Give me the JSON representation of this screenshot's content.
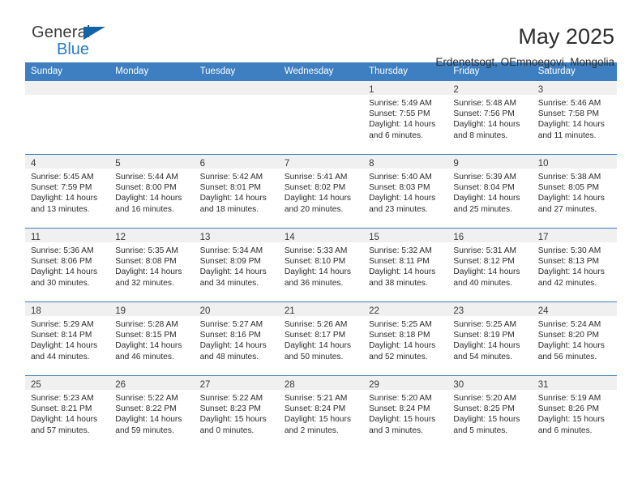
{
  "brand": {
    "name_part1": "General",
    "name_part2": "Blue",
    "accent_color": "#2a7cc7",
    "triangle_color": "#1263a8",
    "triangle_icon": "triangle-icon"
  },
  "header": {
    "title": "May 2025",
    "subtitle": "Erdenetsogt, OEmnoegovi, Mongolia"
  },
  "calendar": {
    "header_bg": "#3d7fc1",
    "header_text_color": "#ffffff",
    "daynum_band_bg": "#f0f0f0",
    "weekdays": [
      "Sunday",
      "Monday",
      "Tuesday",
      "Wednesday",
      "Thursday",
      "Friday",
      "Saturday"
    ],
    "weeks": [
      [
        {
          "day": "",
          "empty": true
        },
        {
          "day": "",
          "empty": true
        },
        {
          "day": "",
          "empty": true
        },
        {
          "day": "",
          "empty": true
        },
        {
          "day": "1",
          "sunrise": "Sunrise: 5:49 AM",
          "sunset": "Sunset: 7:55 PM",
          "daylight1": "Daylight: 14 hours",
          "daylight2": "and 6 minutes."
        },
        {
          "day": "2",
          "sunrise": "Sunrise: 5:48 AM",
          "sunset": "Sunset: 7:56 PM",
          "daylight1": "Daylight: 14 hours",
          "daylight2": "and 8 minutes."
        },
        {
          "day": "3",
          "sunrise": "Sunrise: 5:46 AM",
          "sunset": "Sunset: 7:58 PM",
          "daylight1": "Daylight: 14 hours",
          "daylight2": "and 11 minutes."
        }
      ],
      [
        {
          "day": "4",
          "sunrise": "Sunrise: 5:45 AM",
          "sunset": "Sunset: 7:59 PM",
          "daylight1": "Daylight: 14 hours",
          "daylight2": "and 13 minutes."
        },
        {
          "day": "5",
          "sunrise": "Sunrise: 5:44 AM",
          "sunset": "Sunset: 8:00 PM",
          "daylight1": "Daylight: 14 hours",
          "daylight2": "and 16 minutes."
        },
        {
          "day": "6",
          "sunrise": "Sunrise: 5:42 AM",
          "sunset": "Sunset: 8:01 PM",
          "daylight1": "Daylight: 14 hours",
          "daylight2": "and 18 minutes."
        },
        {
          "day": "7",
          "sunrise": "Sunrise: 5:41 AM",
          "sunset": "Sunset: 8:02 PM",
          "daylight1": "Daylight: 14 hours",
          "daylight2": "and 20 minutes."
        },
        {
          "day": "8",
          "sunrise": "Sunrise: 5:40 AM",
          "sunset": "Sunset: 8:03 PM",
          "daylight1": "Daylight: 14 hours",
          "daylight2": "and 23 minutes."
        },
        {
          "day": "9",
          "sunrise": "Sunrise: 5:39 AM",
          "sunset": "Sunset: 8:04 PM",
          "daylight1": "Daylight: 14 hours",
          "daylight2": "and 25 minutes."
        },
        {
          "day": "10",
          "sunrise": "Sunrise: 5:38 AM",
          "sunset": "Sunset: 8:05 PM",
          "daylight1": "Daylight: 14 hours",
          "daylight2": "and 27 minutes."
        }
      ],
      [
        {
          "day": "11",
          "sunrise": "Sunrise: 5:36 AM",
          "sunset": "Sunset: 8:06 PM",
          "daylight1": "Daylight: 14 hours",
          "daylight2": "and 30 minutes."
        },
        {
          "day": "12",
          "sunrise": "Sunrise: 5:35 AM",
          "sunset": "Sunset: 8:08 PM",
          "daylight1": "Daylight: 14 hours",
          "daylight2": "and 32 minutes."
        },
        {
          "day": "13",
          "sunrise": "Sunrise: 5:34 AM",
          "sunset": "Sunset: 8:09 PM",
          "daylight1": "Daylight: 14 hours",
          "daylight2": "and 34 minutes."
        },
        {
          "day": "14",
          "sunrise": "Sunrise: 5:33 AM",
          "sunset": "Sunset: 8:10 PM",
          "daylight1": "Daylight: 14 hours",
          "daylight2": "and 36 minutes."
        },
        {
          "day": "15",
          "sunrise": "Sunrise: 5:32 AM",
          "sunset": "Sunset: 8:11 PM",
          "daylight1": "Daylight: 14 hours",
          "daylight2": "and 38 minutes."
        },
        {
          "day": "16",
          "sunrise": "Sunrise: 5:31 AM",
          "sunset": "Sunset: 8:12 PM",
          "daylight1": "Daylight: 14 hours",
          "daylight2": "and 40 minutes."
        },
        {
          "day": "17",
          "sunrise": "Sunrise: 5:30 AM",
          "sunset": "Sunset: 8:13 PM",
          "daylight1": "Daylight: 14 hours",
          "daylight2": "and 42 minutes."
        }
      ],
      [
        {
          "day": "18",
          "sunrise": "Sunrise: 5:29 AM",
          "sunset": "Sunset: 8:14 PM",
          "daylight1": "Daylight: 14 hours",
          "daylight2": "and 44 minutes."
        },
        {
          "day": "19",
          "sunrise": "Sunrise: 5:28 AM",
          "sunset": "Sunset: 8:15 PM",
          "daylight1": "Daylight: 14 hours",
          "daylight2": "and 46 minutes."
        },
        {
          "day": "20",
          "sunrise": "Sunrise: 5:27 AM",
          "sunset": "Sunset: 8:16 PM",
          "daylight1": "Daylight: 14 hours",
          "daylight2": "and 48 minutes."
        },
        {
          "day": "21",
          "sunrise": "Sunrise: 5:26 AM",
          "sunset": "Sunset: 8:17 PM",
          "daylight1": "Daylight: 14 hours",
          "daylight2": "and 50 minutes."
        },
        {
          "day": "22",
          "sunrise": "Sunrise: 5:25 AM",
          "sunset": "Sunset: 8:18 PM",
          "daylight1": "Daylight: 14 hours",
          "daylight2": "and 52 minutes."
        },
        {
          "day": "23",
          "sunrise": "Sunrise: 5:25 AM",
          "sunset": "Sunset: 8:19 PM",
          "daylight1": "Daylight: 14 hours",
          "daylight2": "and 54 minutes."
        },
        {
          "day": "24",
          "sunrise": "Sunrise: 5:24 AM",
          "sunset": "Sunset: 8:20 PM",
          "daylight1": "Daylight: 14 hours",
          "daylight2": "and 56 minutes."
        }
      ],
      [
        {
          "day": "25",
          "sunrise": "Sunrise: 5:23 AM",
          "sunset": "Sunset: 8:21 PM",
          "daylight1": "Daylight: 14 hours",
          "daylight2": "and 57 minutes."
        },
        {
          "day": "26",
          "sunrise": "Sunrise: 5:22 AM",
          "sunset": "Sunset: 8:22 PM",
          "daylight1": "Daylight: 14 hours",
          "daylight2": "and 59 minutes."
        },
        {
          "day": "27",
          "sunrise": "Sunrise: 5:22 AM",
          "sunset": "Sunset: 8:23 PM",
          "daylight1": "Daylight: 15 hours",
          "daylight2": "and 0 minutes."
        },
        {
          "day": "28",
          "sunrise": "Sunrise: 5:21 AM",
          "sunset": "Sunset: 8:24 PM",
          "daylight1": "Daylight: 15 hours",
          "daylight2": "and 2 minutes."
        },
        {
          "day": "29",
          "sunrise": "Sunrise: 5:20 AM",
          "sunset": "Sunset: 8:24 PM",
          "daylight1": "Daylight: 15 hours",
          "daylight2": "and 3 minutes."
        },
        {
          "day": "30",
          "sunrise": "Sunrise: 5:20 AM",
          "sunset": "Sunset: 8:25 PM",
          "daylight1": "Daylight: 15 hours",
          "daylight2": "and 5 minutes."
        },
        {
          "day": "31",
          "sunrise": "Sunrise: 5:19 AM",
          "sunset": "Sunset: 8:26 PM",
          "daylight1": "Daylight: 15 hours",
          "daylight2": "and 6 minutes."
        }
      ]
    ]
  }
}
